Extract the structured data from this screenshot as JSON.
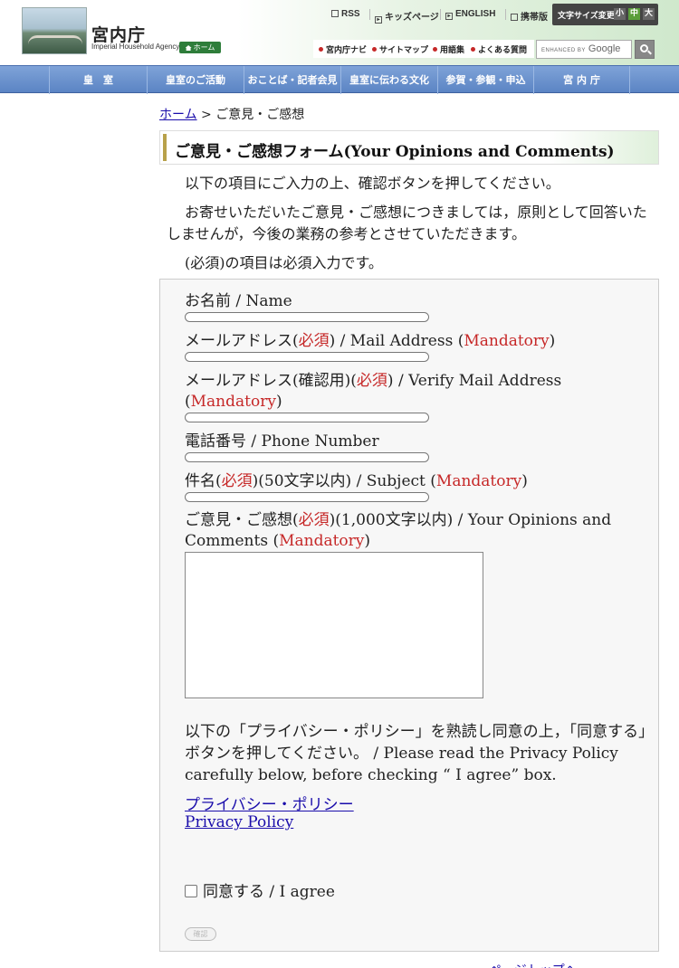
{
  "header": {
    "logo_title": "宮内庁",
    "logo_sub": "Imperial Household Agency",
    "home_badge": "ホーム",
    "links": [
      "RSS",
      "キッズページ",
      "ENGLISH",
      "携帯版"
    ],
    "font_size": {
      "label": "文字サイズ変更",
      "small": "小",
      "medium": "中",
      "large": "大"
    },
    "sublinks": [
      "宮内庁ナビ",
      "サイトマップ",
      "用語集",
      "よくある質問"
    ],
    "search": {
      "enhanced_by": "ENHANCED BY",
      "provider": "Google"
    }
  },
  "nav": [
    "皇　室",
    "皇室のご活動",
    "おことば・記者会見",
    "皇室に伝わる文化",
    "参賀・参観・申込",
    "宮 内 庁"
  ],
  "breadcrumb": {
    "home": "ホーム",
    "separator": " > ",
    "current": "ご意見・ご感想"
  },
  "page_title": "ご意見・ご感想フォーム(Your Opinions and Comments)",
  "intro": {
    "line1": "以下の項目にご入力の上、確認ボタンを押してください。",
    "line2": "お寄せいただいたご意見・ご感想につきましては，原則として回答いたしませんが，今後の業務の参考とさせていただきます。",
    "line3": "(必須)の項目は必須入力です。"
  },
  "form": {
    "name_label": "お名前 / Name",
    "email": {
      "a": "メールアドレス(",
      "req": "必須",
      "b": ") / Mail Address (",
      "mand": "Mandatory",
      "c": ")"
    },
    "email_verify": {
      "a": "メールアドレス(確認用)(",
      "req": "必須",
      "b": ") / Verify Mail Address (",
      "mand": "Mandatory",
      "c": ")"
    },
    "phone_label": "電話番号 / Phone Number",
    "subject": {
      "a": "件名(",
      "req": "必須",
      "b": ")(50文字以内) / Subject (",
      "mand": "Mandatory",
      "c": ")"
    },
    "comments": {
      "a": "ご意見・ご感想(",
      "req": "必須",
      "b": ")(1,000文字以内) / Your Opinions and Comments (",
      "mand": "Mandatory",
      "c": ")"
    },
    "privacy_text": "以下の「プライバシー・ポリシー」を熟読し同意の上，「同意する」ボタンを押してください。 / Please read the Privacy Policy carefully below, before checking “ I agree” box.",
    "privacy_link_ja": "プライバシー・ポリシー",
    "privacy_link_en": "Privacy Policy",
    "agree_label": "同意する / I agree",
    "confirm_button": "確認"
  },
  "footer_peek": "ページトップへ"
}
